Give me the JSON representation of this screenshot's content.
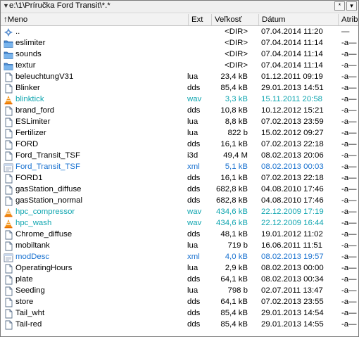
{
  "path_bar": {
    "path": "e:\\1\\Príručka Ford Transit\\*.*",
    "history_button": "*",
    "dropdown_button": "▾"
  },
  "columns": {
    "name": "Meno",
    "ext": "Ext",
    "size": "Veľkosť",
    "date": "Dátum",
    "attr": "Atrib"
  },
  "colors": {
    "cyan": "#11a6b0",
    "blue": "#1a72d0",
    "normal": "#000000"
  },
  "files": [
    {
      "name": "..",
      "ext": "",
      "size": "<DIR>",
      "date": "07.04.2014 11:20",
      "attr": "—",
      "icon": "up-dir",
      "color": "normal"
    },
    {
      "name": "eslimiter",
      "ext": "",
      "size": "<DIR>",
      "date": "07.04.2014 11:14",
      "attr": "-a—",
      "icon": "folder",
      "color": "normal"
    },
    {
      "name": "sounds",
      "ext": "",
      "size": "<DIR>",
      "date": "07.04.2014 11:14",
      "attr": "-a—",
      "icon": "folder",
      "color": "normal"
    },
    {
      "name": "textur",
      "ext": "",
      "size": "<DIR>",
      "date": "07.04.2014 11:14",
      "attr": "-a—",
      "icon": "folder",
      "color": "normal"
    },
    {
      "name": "beleuchtungV31",
      "ext": "lua",
      "size": "23,4 kB",
      "date": "01.12.2011 09:19",
      "attr": "-a—",
      "icon": "file",
      "color": "normal"
    },
    {
      "name": "Blinker",
      "ext": "dds",
      "size": "85,4 kB",
      "date": "29.01.2013 14:51",
      "attr": "-a—",
      "icon": "file",
      "color": "normal"
    },
    {
      "name": "blinktick",
      "ext": "wav",
      "size": "3,3 kB",
      "date": "15.11.2011 20:58",
      "attr": "-a—",
      "icon": "vlc",
      "color": "cyan"
    },
    {
      "name": "brand_ford",
      "ext": "dds",
      "size": "10,8 kB",
      "date": "10.12.2012 15:21",
      "attr": "-a—",
      "icon": "file",
      "color": "normal"
    },
    {
      "name": "ESLimiter",
      "ext": "lua",
      "size": "8,8 kB",
      "date": "07.02.2013 23:59",
      "attr": "-a—",
      "icon": "file",
      "color": "normal"
    },
    {
      "name": "Fertilizer",
      "ext": "lua",
      "size": "822 b",
      "date": "15.02.2012 09:27",
      "attr": "-a—",
      "icon": "file",
      "color": "normal"
    },
    {
      "name": "FORD",
      "ext": "dds",
      "size": "16,1 kB",
      "date": "07.02.2013 22:18",
      "attr": "-a—",
      "icon": "file",
      "color": "normal"
    },
    {
      "name": "Ford_Transit_TSF",
      "ext": "i3d",
      "size": "49,4 M",
      "date": "08.02.2013 20:06",
      "attr": "-a—",
      "icon": "file",
      "color": "normal"
    },
    {
      "name": "Ford_Transit_TSF",
      "ext": "xml",
      "size": "5,1 kB",
      "date": "08.02.2013 00:03",
      "attr": "-a—",
      "icon": "xml",
      "color": "blue"
    },
    {
      "name": "FORD1",
      "ext": "dds",
      "size": "16,1 kB",
      "date": "07.02.2013 22:18",
      "attr": "-a—",
      "icon": "file",
      "color": "normal"
    },
    {
      "name": "gasStation_diffuse",
      "ext": "dds",
      "size": "682,8 kB",
      "date": "04.08.2010 17:46",
      "attr": "-a—",
      "icon": "file",
      "color": "normal"
    },
    {
      "name": "gasStation_normal",
      "ext": "dds",
      "size": "682,8 kB",
      "date": "04.08.2010 17:46",
      "attr": "-a—",
      "icon": "file",
      "color": "normal"
    },
    {
      "name": "hpc_compressor",
      "ext": "wav",
      "size": "434,6 kB",
      "date": "22.12.2009 17:19",
      "attr": "-a—",
      "icon": "vlc",
      "color": "cyan"
    },
    {
      "name": "hpc_wash",
      "ext": "wav",
      "size": "434,6 kB",
      "date": "22.12.2009 16:44",
      "attr": "-a—",
      "icon": "vlc",
      "color": "cyan"
    },
    {
      "name": "Chrome_diffuse",
      "ext": "dds",
      "size": "48,1 kB",
      "date": "19.01.2012 11:02",
      "attr": "-a—",
      "icon": "file",
      "color": "normal"
    },
    {
      "name": "mobiltank",
      "ext": "lua",
      "size": "719 b",
      "date": "16.06.2011 11:51",
      "attr": "-a—",
      "icon": "file",
      "color": "normal"
    },
    {
      "name": "modDesc",
      "ext": "xml",
      "size": "4,0 kB",
      "date": "08.02.2013 19:57",
      "attr": "-a—",
      "icon": "xml",
      "color": "blue"
    },
    {
      "name": "OperatingHours",
      "ext": "lua",
      "size": "2,9 kB",
      "date": "08.02.2013 00:00",
      "attr": "-a—",
      "icon": "file",
      "color": "normal"
    },
    {
      "name": "plate",
      "ext": "dds",
      "size": "64,1 kB",
      "date": "08.02.2013 00:34",
      "attr": "-a—",
      "icon": "file",
      "color": "normal"
    },
    {
      "name": "Seeding",
      "ext": "lua",
      "size": "798 b",
      "date": "02.07.2011 13:47",
      "attr": "-a—",
      "icon": "file",
      "color": "normal"
    },
    {
      "name": "store",
      "ext": "dds",
      "size": "64,1 kB",
      "date": "07.02.2013 23:55",
      "attr": "-a—",
      "icon": "file",
      "color": "normal"
    },
    {
      "name": "Tail_wht",
      "ext": "dds",
      "size": "85,4 kB",
      "date": "29.01.2013 14:54",
      "attr": "-a—",
      "icon": "file",
      "color": "normal"
    },
    {
      "name": "Tail-red",
      "ext": "dds",
      "size": "85,4 kB",
      "date": "29.01.2013 14:55",
      "attr": "-a—",
      "icon": "file",
      "color": "normal"
    }
  ]
}
